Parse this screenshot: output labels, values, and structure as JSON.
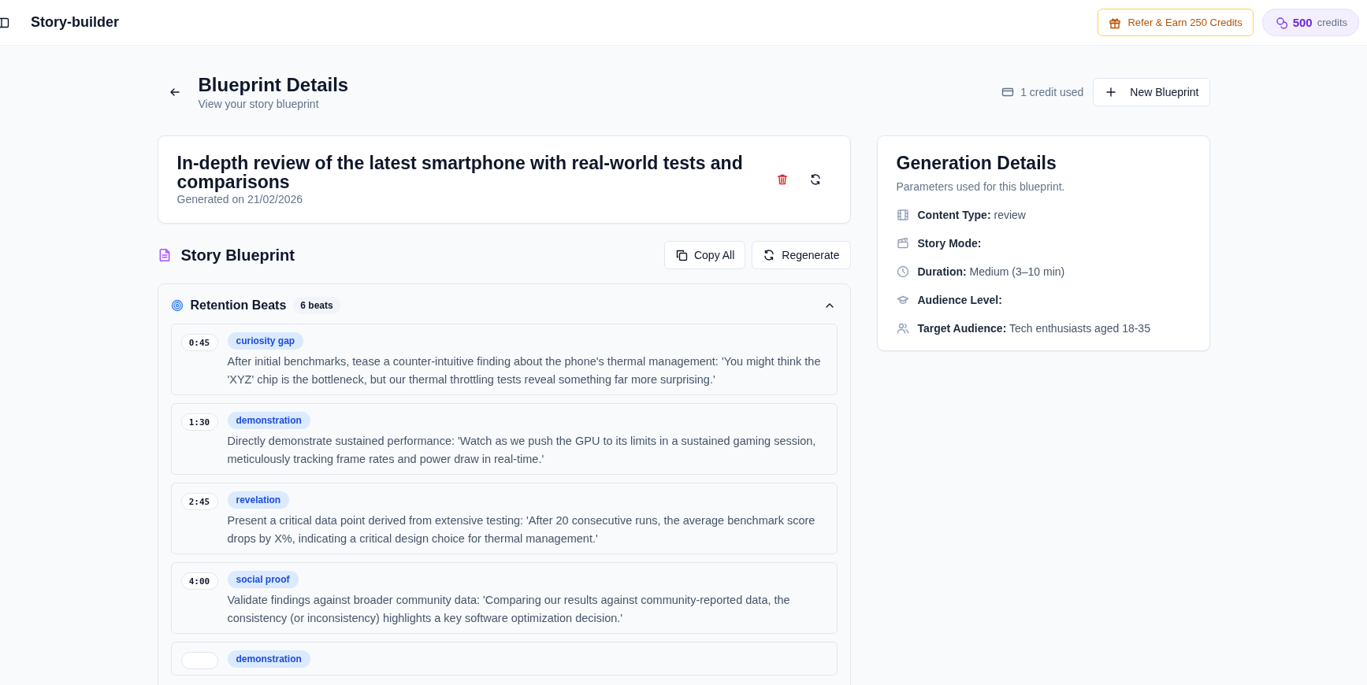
{
  "topbar": {
    "app_name": "Story-builder",
    "refer_button": "Refer & Earn 250 Credits",
    "credits": {
      "amount": "500",
      "label": "credits"
    }
  },
  "header": {
    "title": "Blueprint Details",
    "subtitle": "View your story blueprint",
    "credit_used": "1 credit used",
    "new_button": "New Blueprint"
  },
  "blueprint": {
    "title": "In-depth review of the latest smartphone with real-world tests and comparisons",
    "generated": "Generated on 21/02/2026"
  },
  "story_blueprint": {
    "title": "Story Blueprint",
    "actions": [
      "Copy All",
      "Regenerate"
    ]
  },
  "retention_beats": {
    "title": "Retention Beats",
    "count": "6 beats",
    "expanded": true,
    "beats": [
      {
        "time": "0:45",
        "tag": "curiosity gap",
        "text": "After initial benchmarks, tease a counter-intuitive finding about the phone's thermal management: 'You might think the 'XYZ' chip is the bottleneck, but our thermal throttling tests reveal something far more surprising.'"
      },
      {
        "time": "1:30",
        "tag": "demonstration",
        "text": "Directly demonstrate sustained performance: 'Watch as we push the GPU to its limits in a sustained gaming session, meticulously tracking frame rates and power draw in real-time.'"
      },
      {
        "time": "2:45",
        "tag": "revelation",
        "text": "Present a critical data point derived from extensive testing: 'After 20 consecutive runs, the average benchmark score drops by X%, indicating a critical design choice for thermal management.'"
      },
      {
        "time": "4:00",
        "tag": "social proof",
        "text": "Validate findings against broader community data: 'Comparing our results against community-reported data, the consistency (or inconsistency) highlights a key software optimization decision.'"
      },
      {
        "tag": "demonstration"
      }
    ]
  },
  "generation_details": {
    "title": "Generation Details",
    "subtitle": "Parameters used for this blueprint.",
    "items": [
      {
        "kind": "film",
        "label": "Content Type:",
        "value": "review"
      },
      {
        "kind": "clapper",
        "label": "Story Mode:"
      },
      {
        "kind": "clock",
        "label": "Duration:",
        "value": "Medium (3–10 min)"
      },
      {
        "kind": "cap",
        "label": "Audience Level:"
      },
      {
        "kind": "users",
        "label": "Target Audience:",
        "value": "Tech enthusiasts aged 18-35"
      }
    ]
  }
}
